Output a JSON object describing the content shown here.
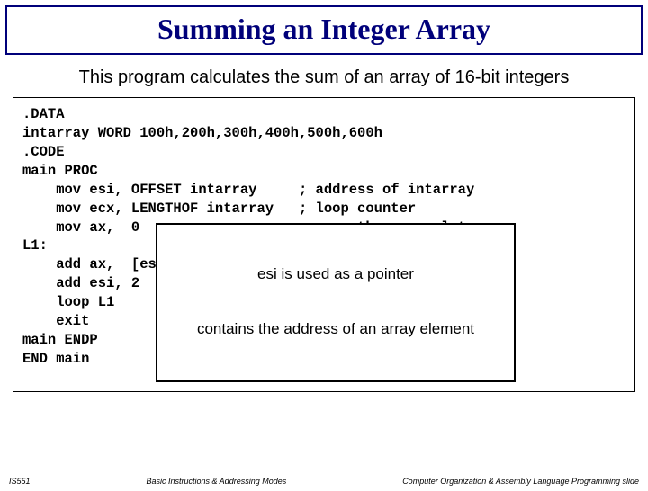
{
  "title": "Summing an Integer Array",
  "subtitle": "This program calculates the sum of an array of 16-bit integers",
  "code": ".DATA\nintarray WORD 100h,200h,300h,400h,500h,600h\n.CODE\nmain PROC\n    mov esi, OFFSET intarray     ; address of intarray\n    mov ecx, LENGTHOF intarray   ; loop counter\n    mov ax,  0                   ; zero the accumulator\nL1:\n    add ax,  [esi]               ; accumulate sum in ax\n    add esi, 2                   ; point to next integer\n    loop L1                      ; repeat until ecx = 0\n    exit\nmain ENDP\nEND main",
  "callout": {
    "line1": "esi is used as a pointer",
    "line2": "contains the address of an array element"
  },
  "footer": {
    "left": "IS551",
    "mid": "Basic Instructions & Addressing Modes",
    "right": "Computer Organization & Assembly Language Programming slide"
  }
}
